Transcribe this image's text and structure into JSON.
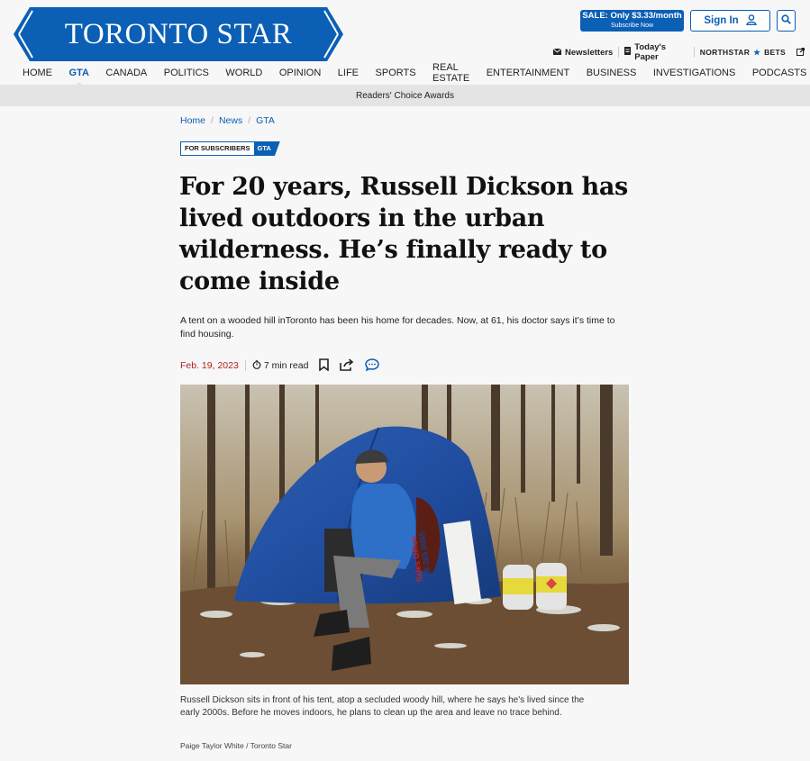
{
  "masthead": {
    "logo_text": "TORONTO STAR",
    "sale": {
      "line1": "SALE: Only $3.33/month",
      "line2": "Subscribe Now"
    },
    "signin_label": "Sign In",
    "utilities": [
      {
        "label": "Newsletters",
        "icon": "mail-icon"
      },
      {
        "label": "Today's Paper",
        "icon": "paper-icon"
      },
      {
        "label": "NORTHSTAR",
        "suffix": "BETS",
        "icon": "external-link-icon"
      }
    ],
    "colors": {
      "brand": "#0b5fb5",
      "date": "#b22222"
    }
  },
  "nav": {
    "items": [
      "HOME",
      "GTA",
      "CANADA",
      "POLITICS",
      "WORLD",
      "OPINION",
      "LIFE",
      "SPORTS",
      "REAL ESTATE",
      "ENTERTAINMENT",
      "BUSINESS",
      "INVESTIGATIONS",
      "PODCASTS"
    ],
    "active": "GTA",
    "subnav_label": "Readers' Choice Awards"
  },
  "article": {
    "breadcrumb": [
      "Home",
      "News",
      "GTA"
    ],
    "tag_subscribers": "FOR SUBSCRIBERS",
    "tag_section": "GTA",
    "headline": "For 20 years, Russell Dickson has lived outdoors in the urban wilderness. He’s finally ready to come inside",
    "dek": "A tent on a wooded hill inToronto has been his home for decades. Now, at 61, his doctor says it’s time to find housing.",
    "date": "Feb. 19, 2023",
    "read_time": "7 min read",
    "photo_caption": "Russell Dickson sits in front of his tent, atop a secluded woody hill, where he says he's lived since the early 2000s. Before he moves indoors, he plans to clean up the area and leave no trace behind.",
    "photo_credit": "Paige Taylor White / Toronto Star",
    "photo_sign_text": [
      "Sales",
      "Office",
      "416.385.9995"
    ]
  }
}
